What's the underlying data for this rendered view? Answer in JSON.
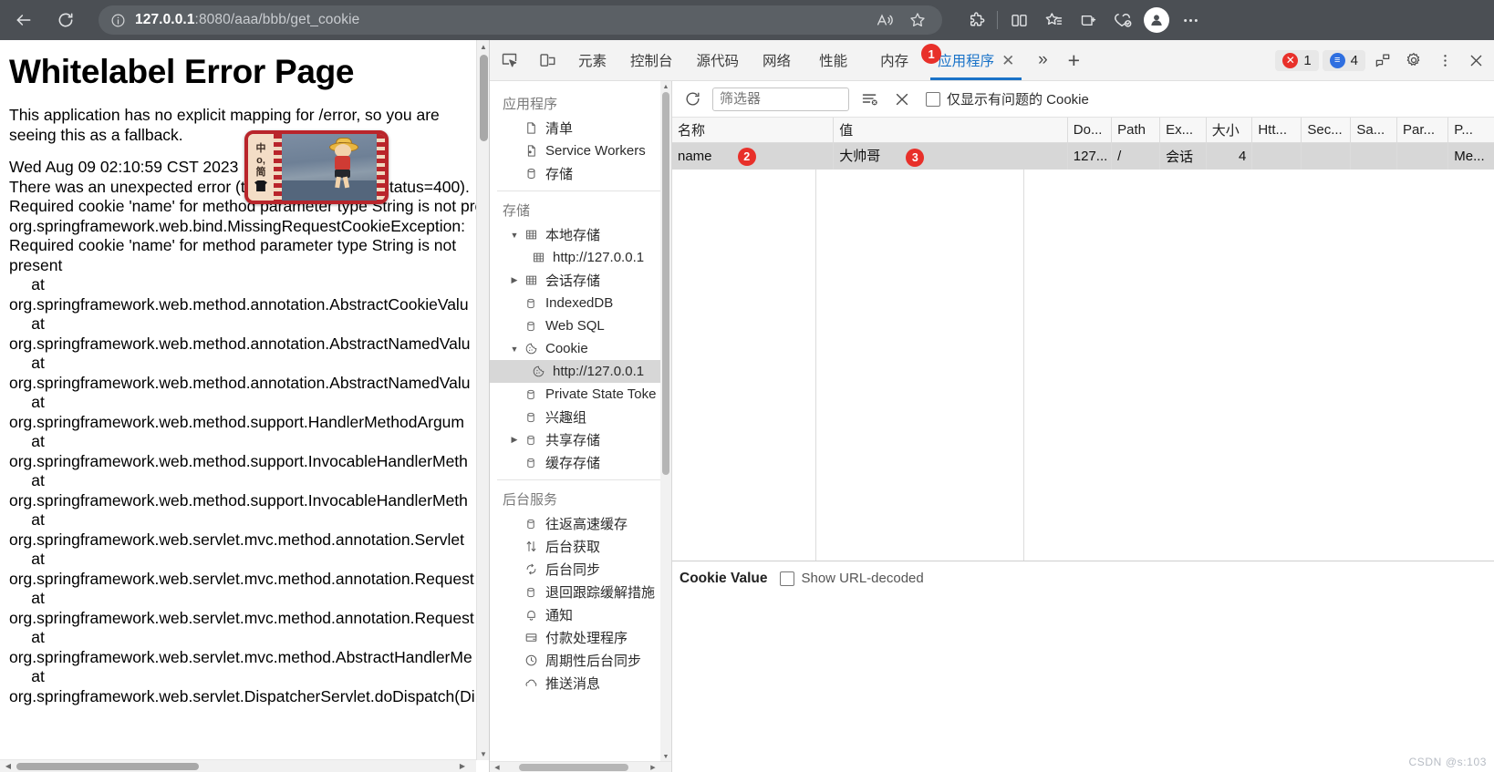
{
  "browser": {
    "back_label": "back-arrow",
    "reload_label": "reload",
    "url_host": "127.0.0.1",
    "url_rest": ":8080/aaa/bbb/get_cookie",
    "info_icon": "info-icon",
    "read_aloud_icon": "read-aloud-icon",
    "favorite_icon": "star-icon",
    "extensions_icon": "extensions-icon",
    "split_screen_icon": "split-screen-icon",
    "collections_icon": "collections-icon",
    "browser_essentials_icon": "browser-essentials-icon",
    "copilot_icon": "copilot-icon",
    "profile_icon": "profile-avatar-icon",
    "settings_more_icon": "ellipsis-icon"
  },
  "page": {
    "title": "Whitelabel Error Page",
    "intro": "This application has no explicit mapping for /error, so you are seeing this as a fallback.",
    "timestamp": "Wed Aug 09 02:10:59 CST 2023",
    "error_line": "There was an unexpected error (type=Bad Request, status=400).",
    "error_detail": "Required cookie 'name' for method parameter type String is not present",
    "trace": "org.springframework.web.bind.MissingRequestCookieException:\nRequired cookie 'name' for method parameter type String is not\npresent\n     at\norg.springframework.web.method.annotation.AbstractCookieValu\n     at\norg.springframework.web.method.annotation.AbstractNamedValu\n     at\norg.springframework.web.method.annotation.AbstractNamedValu\n     at\norg.springframework.web.method.support.HandlerMethodArgum\n     at\norg.springframework.web.method.support.InvocableHandlerMeth\n     at\norg.springframework.web.method.support.InvocableHandlerMeth\n     at\norg.springframework.web.servlet.mvc.method.annotation.Servlet\n     at\norg.springframework.web.servlet.mvc.method.annotation.Request\n     at\norg.springframework.web.servlet.mvc.method.annotation.Request\n     at\norg.springframework.web.servlet.mvc.method.AbstractHandlerMe\n     at\norg.springframework.web.servlet.DispatcherServlet.doDispatch(Di"
  },
  "widget": {
    "side_text_1": "中",
    "side_text_2": "o,",
    "side_text_3": "简",
    "alt": "anime-character-thumbnail"
  },
  "devtools": {
    "inspect_icon": "inspect-element-icon",
    "device_icon": "device-toolbar-icon",
    "tabs": [
      {
        "label": "元素",
        "active": false
      },
      {
        "label": "控制台",
        "active": false
      },
      {
        "label": "源代码",
        "active": false
      },
      {
        "label": "网络",
        "active": false
      },
      {
        "label": "性能",
        "active": false
      },
      {
        "label": "内存",
        "active": false
      },
      {
        "label": "应用程序",
        "active": true,
        "badge": "1"
      }
    ],
    "tab_close_icon": "close-icon",
    "more_tabs_icon": "chevron-double-right-icon",
    "add_tab_icon": "plus-icon",
    "error_count": "1",
    "message_count": "4",
    "customize_icon": "customize-devtools-icon",
    "settings_icon": "gear-icon",
    "dock_icon": "dock-icon",
    "close_icon": "close-icon",
    "sidebar": {
      "groups": [
        {
          "title": "应用程序",
          "items": [
            {
              "label": "清单",
              "icon": "manifest-icon",
              "indent": 0,
              "twisty": "none",
              "selected": false
            },
            {
              "label": "Service Workers",
              "icon": "service-worker-icon",
              "indent": 0,
              "twisty": "none",
              "selected": false
            },
            {
              "label": "存储",
              "icon": "storage-icon",
              "indent": 0,
              "twisty": "none",
              "selected": false
            }
          ]
        },
        {
          "title": "存储",
          "items": [
            {
              "label": "本地存储",
              "icon": "table-icon",
              "indent": 0,
              "twisty": "open",
              "selected": false
            },
            {
              "label": "http://127.0.0.1",
              "icon": "table-icon",
              "indent": 1,
              "twisty": "none",
              "selected": false
            },
            {
              "label": "会话存储",
              "icon": "table-icon",
              "indent": 0,
              "twisty": "closed",
              "selected": false
            },
            {
              "label": "IndexedDB",
              "icon": "database-icon",
              "indent": 0,
              "twisty": "none",
              "selected": false
            },
            {
              "label": "Web SQL",
              "icon": "database-icon",
              "indent": 0,
              "twisty": "none",
              "selected": false
            },
            {
              "label": "Cookie",
              "icon": "cookie-icon",
              "indent": 0,
              "twisty": "open",
              "selected": false
            },
            {
              "label": "http://127.0.0.1",
              "icon": "cookie-icon",
              "indent": 1,
              "twisty": "none",
              "selected": true
            },
            {
              "label": "Private State Toke",
              "icon": "database-icon",
              "indent": 0,
              "twisty": "none",
              "selected": false
            },
            {
              "label": "兴趣组",
              "icon": "database-icon",
              "indent": 0,
              "twisty": "none",
              "selected": false
            },
            {
              "label": "共享存储",
              "icon": "database-icon",
              "indent": 0,
              "twisty": "closed",
              "selected": false
            },
            {
              "label": "缓存存储",
              "icon": "database-icon",
              "indent": 0,
              "twisty": "none",
              "selected": false
            }
          ]
        },
        {
          "title": "后台服务",
          "items": [
            {
              "label": "往返高速缓存",
              "icon": "database-icon",
              "indent": 0,
              "twisty": "none",
              "selected": false
            },
            {
              "label": "后台获取",
              "icon": "arrows-updown-icon",
              "indent": 0,
              "twisty": "none",
              "selected": false
            },
            {
              "label": "后台同步",
              "icon": "sync-icon",
              "indent": 0,
              "twisty": "none",
              "selected": false
            },
            {
              "label": "退回跟踪缓解措施",
              "icon": "database-icon",
              "indent": 0,
              "twisty": "none",
              "selected": false
            },
            {
              "label": "通知",
              "icon": "bell-icon",
              "indent": 0,
              "twisty": "none",
              "selected": false
            },
            {
              "label": "付款处理程序",
              "icon": "payment-icon",
              "indent": 0,
              "twisty": "none",
              "selected": false
            },
            {
              "label": "周期性后台同步",
              "icon": "clock-icon",
              "indent": 0,
              "twisty": "none",
              "selected": false
            },
            {
              "label": "推送消息",
              "icon": "cloud-icon",
              "indent": 0,
              "twisty": "none",
              "selected": false
            }
          ]
        }
      ]
    },
    "cookie_panel": {
      "refresh_icon": "refresh-icon",
      "filter_placeholder": "筛选器",
      "filter_value": "",
      "clear_filtered_icon": "clear-filtered-cookies-icon",
      "clear_all_icon": "clear-all-cookies-icon",
      "only_problem_label": "仅显示有问题的 Cookie",
      "only_problem_checked": false,
      "columns": [
        "名称",
        "值",
        "Do...",
        "Path",
        "Ex...",
        "大小",
        "Htt...",
        "Sec...",
        "Sa...",
        "Par...",
        "P..."
      ],
      "rows": [
        {
          "name": "name",
          "name_badge": "2",
          "value": "大帅哥",
          "value_badge": "3",
          "domain": "127...",
          "path": "/",
          "expires": "会话",
          "size": "4",
          "httponly": "",
          "secure": "",
          "samesite": "",
          "partition": "",
          "priority": "Me..."
        }
      ],
      "value_panel_title": "Cookie Value",
      "show_url_decoded_label": "Show URL-decoded",
      "show_url_decoded_checked": false
    }
  },
  "watermark": "CSDN @s:103"
}
